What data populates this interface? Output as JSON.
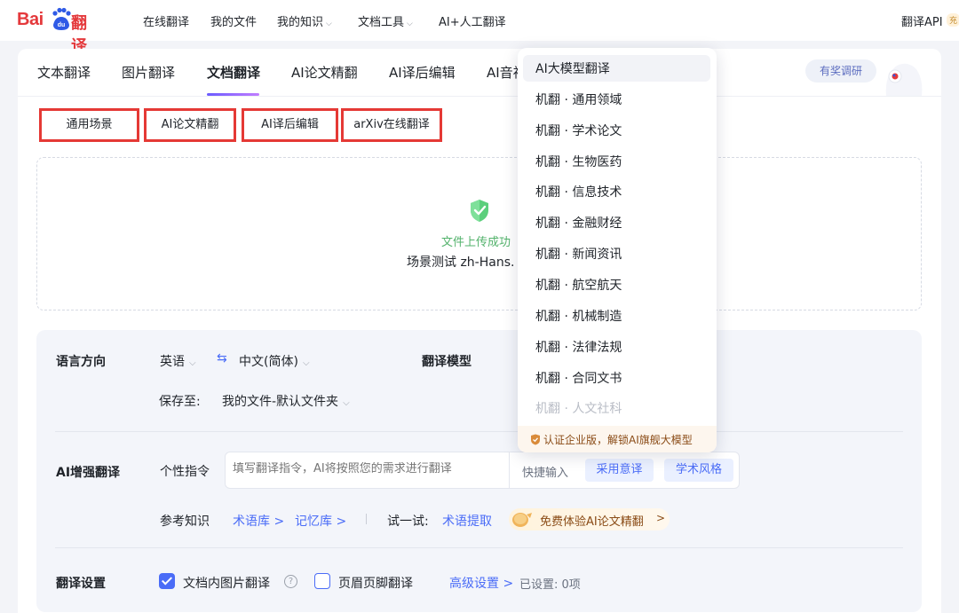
{
  "logo": {
    "brand_text": "Bai",
    "paw_text": "du",
    "product_text": "翻译"
  },
  "topnav": {
    "items": [
      {
        "label": "在线翻译",
        "has_dropdown": false
      },
      {
        "label": "我的文件",
        "has_dropdown": false
      },
      {
        "label": "我的知识",
        "has_dropdown": true
      },
      {
        "label": "文档工具",
        "has_dropdown": true
      },
      {
        "label": "AI+人工翻译",
        "has_dropdown": false
      }
    ],
    "api_label": "翻译API",
    "api_badge": "充"
  },
  "tabs": {
    "items": [
      "文本翻译",
      "图片翻译",
      "文档翻译",
      "AI论文精翻",
      "AI译后编辑",
      "AI音视"
    ],
    "active": "文档翻译",
    "survey_label": "有奖调研"
  },
  "scenes": [
    "通用场景",
    "AI论文精翻",
    "AI译后编辑",
    "arXiv在线翻译"
  ],
  "upload": {
    "status": "文件上传成功",
    "file_name": "场景测试 zh-Hans."
  },
  "settings": {
    "lang_direction_label": "语言方向",
    "source_lang": "英语",
    "target_lang": "中文(简体)",
    "model_label": "翻译模型",
    "save_label": "保存至:",
    "save_location": "我的文件-默认文件夹",
    "ai_enhance_label": "AI增强翻译",
    "instruction_label": "个性指令",
    "instruction_placeholder": "填写翻译指令，AI将按照您的需求进行翻译",
    "quick_input_label": "快捷输入",
    "quick_chips": [
      "采用意译",
      "学术风格"
    ],
    "ref_knowledge_label": "参考知识",
    "glossary_link": "术语库 >",
    "memory_link": "记忆库 >",
    "try_label": "试一试:",
    "term_extract_link": "术语提取",
    "promo_text": "免费体验AI论文精翻",
    "promo_chevron": ">",
    "translate_settings_label": "翻译设置",
    "img_translate_label": "文档内图片翻译",
    "img_translate_checked": true,
    "header_footer_label": "页眉页脚翻译",
    "header_footer_checked": false,
    "advanced_label": "高级设置 >",
    "configured_text": "已设置: 0项"
  },
  "model_dropdown": {
    "items": [
      "AI大模型翻译",
      "机翻 · 通用领域",
      "机翻 · 学术论文",
      "机翻 · 生物医药",
      "机翻 · 信息技术",
      "机翻 · 金融财经",
      "机翻 · 新闻资讯",
      "机翻 · 航空航天",
      "机翻 · 机械制造",
      "机翻 · 法律法规",
      "机翻 · 合同文书",
      "机翻 · 人文社科"
    ],
    "selected": "AI大模型翻译",
    "footer_text": "认证企业版，解锁AI旗舰大模型"
  },
  "colors": {
    "brand_red": "#e4393c",
    "accent_blue": "#4a6cf7",
    "highlight_border": "#e53935",
    "success_green": "#52b26b",
    "promo_brown": "#8a4b16"
  }
}
